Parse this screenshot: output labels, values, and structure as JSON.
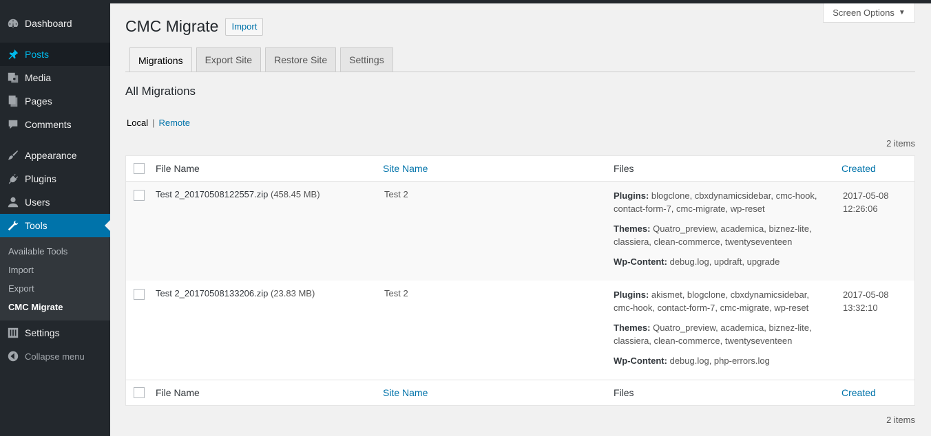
{
  "sidebar": {
    "items": [
      {
        "label": "Dashboard",
        "icon": "dashboard-icon"
      },
      {
        "label": "Posts",
        "icon": "pin-icon"
      },
      {
        "label": "Media",
        "icon": "media-icon"
      },
      {
        "label": "Pages",
        "icon": "pages-icon"
      },
      {
        "label": "Comments",
        "icon": "comment-icon"
      },
      {
        "label": "Appearance",
        "icon": "brush-icon"
      },
      {
        "label": "Plugins",
        "icon": "plugin-icon"
      },
      {
        "label": "Users",
        "icon": "user-icon"
      },
      {
        "label": "Tools",
        "icon": "wrench-icon"
      }
    ],
    "tools_submenu": [
      "Available Tools",
      "Import",
      "Export",
      "CMC Migrate"
    ],
    "settings": {
      "label": "Settings",
      "icon": "settings-icon"
    },
    "collapse": {
      "label": "Collapse menu",
      "icon": "collapse-icon"
    },
    "colors": {
      "bg": "#23282d",
      "active": "#0073aa",
      "link_active": "#00b9eb"
    }
  },
  "screen_options": {
    "label": "Screen Options",
    "arrow": "▼"
  },
  "page": {
    "title": "CMC Migrate",
    "import_button": "Import",
    "tabs": [
      "Migrations",
      "Export Site",
      "Restore Site",
      "Settings"
    ],
    "subtitle": "All Migrations",
    "filters": {
      "local": "Local",
      "separator": "|",
      "remote": "Remote"
    },
    "count": "2 items"
  },
  "table": {
    "columns": {
      "file": "File Name",
      "site": "Site Name",
      "files": "Files",
      "created": "Created"
    },
    "rows": [
      {
        "file": "Test 2_20170508122557.zip",
        "size": "(458.45 MB)",
        "site": "Test 2",
        "plugins_label": "Plugins:",
        "plugins": "blogclone, cbxdynamicsidebar, cmc-hook, contact-form-7, cmc-migrate, wp-reset",
        "themes_label": "Themes:",
        "themes": "Quatro_preview, academica, biznez-lite, classiera, clean-commerce, twentyseventeen",
        "content_label": "Wp-Content:",
        "content": "debug.log, updraft, upgrade",
        "date": "2017-05-08",
        "time": "12:26:06"
      },
      {
        "file": "Test 2_20170508133206.zip",
        "size": "(23.83 MB)",
        "site": "Test 2",
        "plugins_label": "Plugins:",
        "plugins": "akismet, blogclone, cbxdynamicsidebar, cmc-hook, contact-form-7, cmc-migrate, wp-reset",
        "themes_label": "Themes:",
        "themes": "Quatro_preview, academica, biznez-lite, classiera, clean-commerce, twentyseventeen",
        "content_label": "Wp-Content:",
        "content": "debug.log, php-errors.log",
        "date": "2017-05-08",
        "time": "13:32:10"
      }
    ]
  }
}
